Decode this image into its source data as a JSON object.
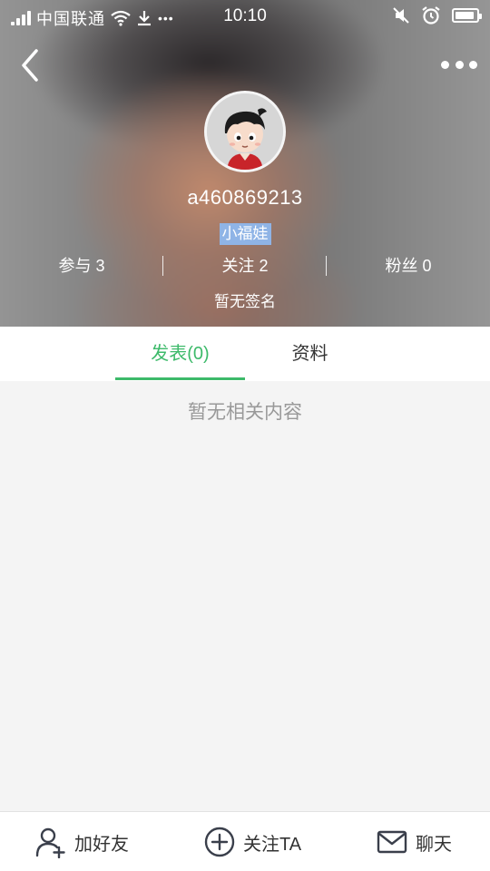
{
  "status_bar": {
    "carrier": "中国联通",
    "time": "10:10",
    "icons": [
      "signal-icon",
      "wifi-icon",
      "download-icon",
      "ellipsis-icon",
      "mute-icon",
      "alarm-icon",
      "battery-icon"
    ],
    "more_dots": "•••"
  },
  "nav": {
    "back_icon": "chevron-left-icon",
    "more_icon": "more-dots-icon"
  },
  "profile": {
    "avatar_icon": "cartoon-boy-avatar",
    "username": "a460869213",
    "badge": "小福娃",
    "stats": [
      {
        "label": "参与",
        "value": "3"
      },
      {
        "label": "关注",
        "value": "2"
      },
      {
        "label": "粉丝",
        "value": "0"
      }
    ],
    "signature": "暂无签名"
  },
  "tabs": {
    "posts": "发表(0)",
    "info": "资料",
    "active": "posts"
  },
  "content": {
    "empty_text": "暂无相关内容"
  },
  "bottom_bar": {
    "add_friend": "加好友",
    "follow": "关注TA",
    "chat": "聊天"
  },
  "colors": {
    "accent_green": "#3dba6a",
    "badge_blue": "#8fb4e6",
    "background": "#f4f4f4"
  }
}
